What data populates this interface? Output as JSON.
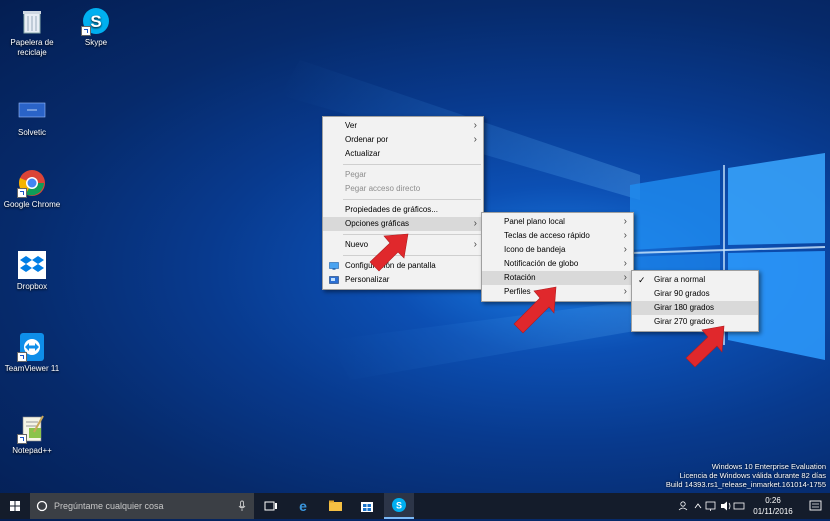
{
  "desktop_icons": [
    {
      "id": "recycle",
      "label": "Papelera de reciclaje"
    },
    {
      "id": "skype",
      "label": "Skype"
    },
    {
      "id": "solvetic",
      "label": "Solvetic"
    },
    {
      "id": "chrome",
      "label": "Google Chrome"
    },
    {
      "id": "dropbox",
      "label": "Dropbox"
    },
    {
      "id": "teamviewer",
      "label": "TeamViewer 11"
    },
    {
      "id": "notepad",
      "label": "Notepad++"
    }
  ],
  "context_menu": {
    "items": [
      {
        "label": "Ver",
        "submenu": true
      },
      {
        "label": "Ordenar por",
        "submenu": true
      },
      {
        "label": "Actualizar"
      },
      {
        "label": "Pegar",
        "disabled": true
      },
      {
        "label": "Pegar acceso directo",
        "disabled": true
      },
      {
        "label": "Propiedades de gráficos..."
      },
      {
        "label": "Opciones gráficas",
        "submenu": true,
        "highlighted": true
      },
      {
        "label": "Nuevo",
        "submenu": true
      },
      {
        "label": "Configuración de pantalla",
        "icon": "display-icon"
      },
      {
        "label": "Personalizar",
        "icon": "personalize-icon"
      }
    ]
  },
  "graphics_submenu": {
    "items": [
      {
        "label": "Panel plano local"
      },
      {
        "label": "Teclas de acceso rápido"
      },
      {
        "label": "Icono de bandeja"
      },
      {
        "label": "Notificación de globo"
      },
      {
        "label": "Rotación",
        "highlighted": true
      },
      {
        "label": "Perfiles"
      }
    ]
  },
  "rotation_submenu": {
    "items": [
      {
        "label": "Girar a normal",
        "checked": true
      },
      {
        "label": "Girar 90 grados"
      },
      {
        "label": "Girar 180 grados",
        "highlighted": true
      },
      {
        "label": "Girar 270 grados"
      }
    ]
  },
  "watermark": {
    "line1": "Windows 10 Enterprise Evaluation",
    "line2": "Licencia de Windows válida durante 82 días",
    "line3": "Build 14393.rs1_release_inmarket.161014-1755"
  },
  "taskbar": {
    "search_placeholder": "Pregúntame cualquier cosa",
    "clock_time": "0:26",
    "clock_date": "01/11/2016"
  },
  "colors": {
    "menu_bg": "#f2f2f2",
    "highlight": "#d9d9d9",
    "annotation_arrow": "#e0282c",
    "taskbar": "#141c2b"
  }
}
